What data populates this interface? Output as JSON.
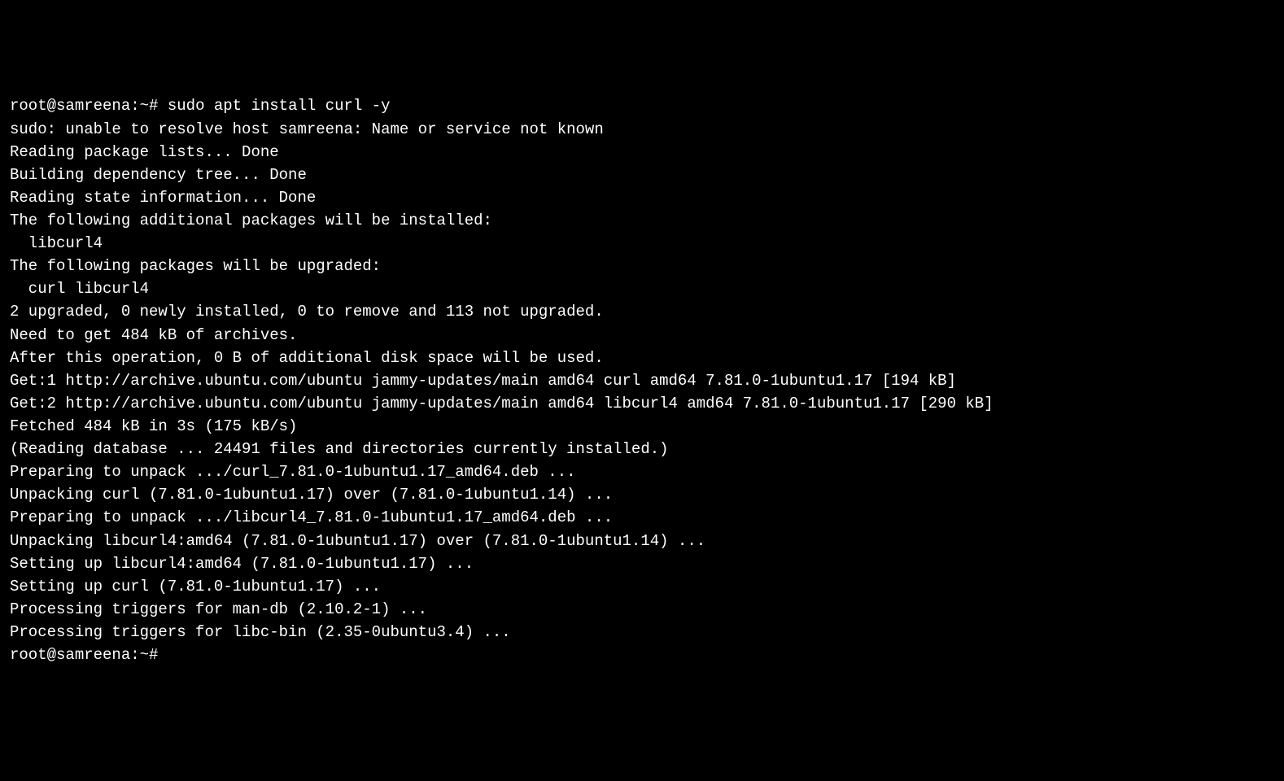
{
  "terminal": {
    "prompt1": {
      "user": "root@samreena",
      "sep": ":",
      "path": "~",
      "hash": "# "
    },
    "command1": "sudo apt install curl -y",
    "output": [
      "sudo: unable to resolve host samreena: Name or service not known",
      "Reading package lists... Done",
      "Building dependency tree... Done",
      "Reading state information... Done",
      "The following additional packages will be installed:",
      "  libcurl4",
      "The following packages will be upgraded:",
      "  curl libcurl4",
      "2 upgraded, 0 newly installed, 0 to remove and 113 not upgraded.",
      "Need to get 484 kB of archives.",
      "After this operation, 0 B of additional disk space will be used.",
      "Get:1 http://archive.ubuntu.com/ubuntu jammy-updates/main amd64 curl amd64 7.81.0-1ubuntu1.17 [194 kB]",
      "Get:2 http://archive.ubuntu.com/ubuntu jammy-updates/main amd64 libcurl4 amd64 7.81.0-1ubuntu1.17 [290 kB]",
      "Fetched 484 kB in 3s (175 kB/s)",
      "(Reading database ... 24491 files and directories currently installed.)",
      "Preparing to unpack .../curl_7.81.0-1ubuntu1.17_amd64.deb ...",
      "Unpacking curl (7.81.0-1ubuntu1.17) over (7.81.0-1ubuntu1.14) ...",
      "Preparing to unpack .../libcurl4_7.81.0-1ubuntu1.17_amd64.deb ...",
      "Unpacking libcurl4:amd64 (7.81.0-1ubuntu1.17) over (7.81.0-1ubuntu1.14) ...",
      "Setting up libcurl4:amd64 (7.81.0-1ubuntu1.17) ...",
      "Setting up curl (7.81.0-1ubuntu1.17) ...",
      "Processing triggers for man-db (2.10.2-1) ...",
      "Processing triggers for libc-bin (2.35-0ubuntu3.4) ..."
    ],
    "prompt2": {
      "user": "root@samreena",
      "sep": ":",
      "path": "~",
      "hash": "#"
    }
  }
}
